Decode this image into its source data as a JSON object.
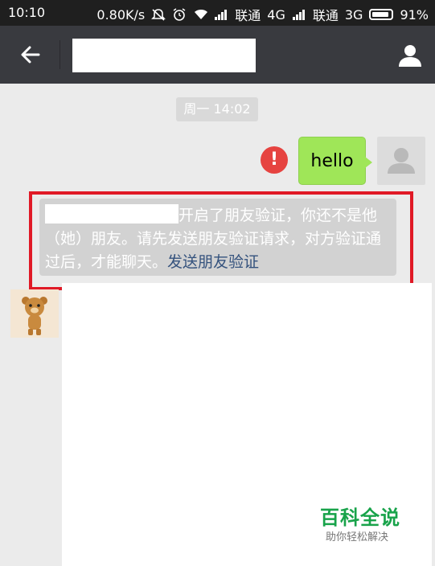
{
  "status_bar": {
    "time": "10:10",
    "speed": "0.80K/s",
    "carrier1": "联通",
    "network1": "4G",
    "carrier2": "联通",
    "network2": "3G",
    "battery": "91%"
  },
  "header": {
    "back_icon": "arrow-left-icon",
    "profile_icon": "person-icon"
  },
  "chat": {
    "timestamp": "周一 14:02",
    "outgoing_message": "hello",
    "send_failed_icon": "exclamation-icon",
    "notice_text": "开启了朋友验证，你还不是他（她）朋友。请先发送朋友验证请求，对方验证通过后，才能聊天。",
    "notice_link": "发送朋友验证"
  },
  "watermark": {
    "title": "百科全说",
    "subtitle": "助你轻松解决"
  },
  "colors": {
    "header_bg": "#393a3f",
    "bubble_green": "#9fe658",
    "error_red": "#e64340",
    "highlight_red": "#e01926",
    "link_blue": "#34527d",
    "watermark_green": "#18a34a"
  }
}
